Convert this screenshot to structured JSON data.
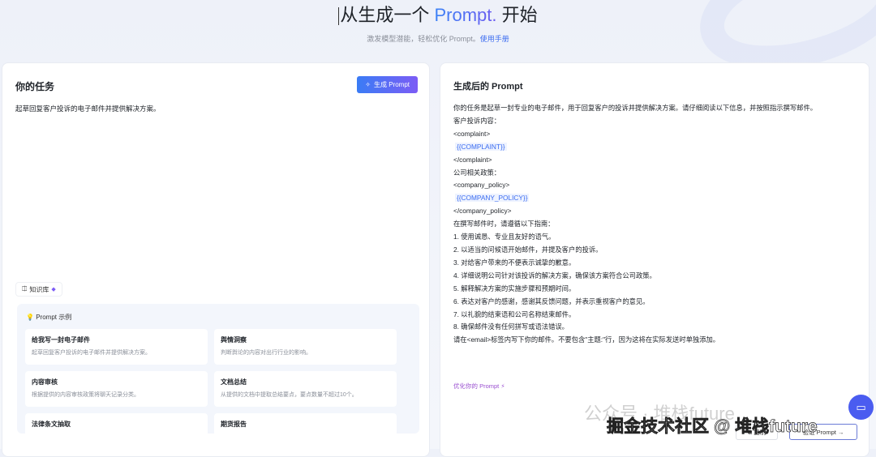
{
  "hero": {
    "title_prefix": "从生成一个 ",
    "title_accent": "Prompt.",
    "title_suffix": " 开始",
    "subtitle": "激发模型潜能，轻松优化 Prompt。",
    "manual_link": "使用手册"
  },
  "left": {
    "title": "你的任务",
    "generate_button": "生成 Prompt",
    "task_text": "起草回复客户投诉的电子邮件并提供解决方案。",
    "knowledge_base": "知识库",
    "examples_title": "Prompt 示例",
    "examples": [
      {
        "title": "给我写一封电子邮件",
        "desc": "起草回复客户投诉的电子邮件并提供解决方案。"
      },
      {
        "title": "舆情洞察",
        "desc": "判断舆论的内容对出行行业的影响。"
      },
      {
        "title": "内容审核",
        "desc": "根据提供的内容审核政策将聊天记录分类。"
      },
      {
        "title": "文档总结",
        "desc": "从提供的文档中提取总结要点，要点数量不超过10个。"
      },
      {
        "title": "法律条文抽取",
        "desc": ""
      },
      {
        "title": "期货报告",
        "desc": ""
      }
    ]
  },
  "right": {
    "title": "生成后的 Prompt",
    "lines": [
      "你的任务是起草一封专业的电子邮件，用于回复客户的投诉并提供解决方案。请仔细阅读以下信息，并按照指示撰写邮件。",
      "客户投诉内容：",
      "<complaint>",
      "{{COMPLAINT}}",
      "</complaint>",
      "公司相关政策：",
      "<company_policy>",
      "{{COMPANY_POLICY}}",
      "</company_policy>",
      "在撰写邮件时，请遵循以下指南：",
      "1. 使用诚恳、专业且友好的语气。",
      "2. 以适当的问候语开始邮件，并提及客户的投诉。",
      "3. 对给客户带来的不便表示诚挚的歉意。",
      "4. 详细说明公司针对该投诉的解决方案，确保该方案符合公司政策。",
      "5. 解释解决方案的实施步骤和预期时间。",
      "6. 表达对客户的感谢，感谢其反馈问题，并表示重视客户的意见。",
      "7. 以礼貌的结束语和公司名称结束邮件。",
      "8. 确保邮件没有任何拼写或语法错误。",
      "请在<email>标签内写下你的邮件。不要包含\"主题:\"行，因为这将在实际发送时单独添加。"
    ],
    "optimize_link": "优化你的 Prompt",
    "copy_button": "复制",
    "verify_button": "验证 Prompt →"
  },
  "watermark": {
    "line1": "公众号 · 堆栈future",
    "line2": "掘金技术社区 @ 堆栈future"
  }
}
